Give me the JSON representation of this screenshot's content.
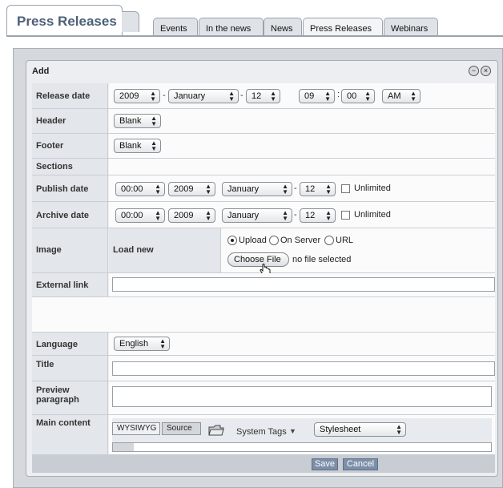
{
  "page_title": "Press Releases",
  "tabs": [
    {
      "label": "Events"
    },
    {
      "label": "In the news"
    },
    {
      "label": "News"
    },
    {
      "label": "Press Releases",
      "active": true
    },
    {
      "label": "Webinars"
    }
  ],
  "panel": {
    "title": "Add",
    "minimize_glyph": "−",
    "close_glyph": "×"
  },
  "form": {
    "release_date": {
      "label": "Release date",
      "year": "2009",
      "month": "January",
      "day": "12",
      "hour": "09",
      "minute": "00",
      "ampm": "AM",
      "sep_dash": "-",
      "sep_colon": ":"
    },
    "header": {
      "label": "Header",
      "value": "Blank"
    },
    "footer": {
      "label": "Footer",
      "value": "Blank"
    },
    "sections": {
      "label": "Sections"
    },
    "publish_date": {
      "label": "Publish date",
      "time": "00:00",
      "year": "2009",
      "month": "January",
      "day": "12",
      "unlimited_label": "Unlimited",
      "unlimited_checked": false
    },
    "archive_date": {
      "label": "Archive date",
      "time": "00:00",
      "year": "2009",
      "month": "January",
      "day": "12",
      "unlimited_label": "Unlimited",
      "unlimited_checked": false
    },
    "image": {
      "label": "Image",
      "sub_label": "Load new",
      "source_options": [
        "Upload",
        "On Server",
        "URL"
      ],
      "selected_source": "Upload",
      "choose_file_label": "Choose File",
      "file_status": "no file selected"
    },
    "external_link": {
      "label": "External link",
      "value": ""
    },
    "language": {
      "label": "Language",
      "value": "English"
    },
    "title": {
      "label": "Title",
      "value": ""
    },
    "preview_paragraph": {
      "label_line1": "Preview",
      "label_line2": "paragraph",
      "value": ""
    },
    "main_content": {
      "label": "Main content",
      "editor_tabs": [
        "WYSIWYG",
        "Source"
      ],
      "active_editor_tab": "WYSIWYG",
      "system_tags_label": "System Tags",
      "stylesheet_value": "Stylesheet"
    }
  },
  "actions": {
    "save_label": "Save",
    "cancel_label": "Cancel"
  },
  "icons": {
    "folder": "folder-icon",
    "caret": "caret-down-icon"
  }
}
